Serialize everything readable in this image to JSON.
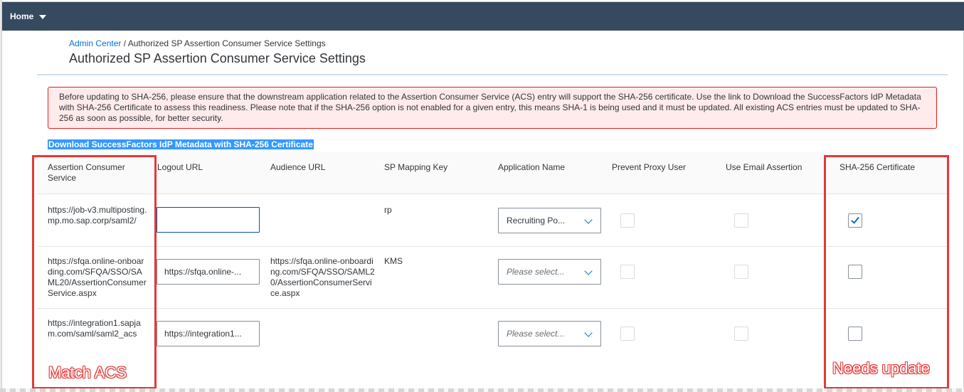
{
  "topbar": {
    "home_label": "Home"
  },
  "breadcrumb": {
    "link": "Admin Center",
    "separator": "/",
    "current": "Authorized SP Assertion Consumer Service Settings"
  },
  "page_title": "Authorized SP Assertion Consumer Service Settings",
  "alert_text": "Before updating to SHA-256, please ensure that the downstream application related to the Assertion Consumer Service (ACS) entry will support the SHA-256 certificate. Use the link to Download the SuccessFactors IdP Metadata with SHA-256 Certificate to assess this readiness. Please note that if the SHA-256 option is not enabled for a given entry, this means SHA-1 is being used and it must be updated. All existing ACS entries must be updated to SHA-256 as soon as possible, for better security.",
  "download_link": "Download SuccessFactors IdP Metadata with SHA-256 Certificate",
  "table": {
    "headers": {
      "acs": "Assertion Consumer Service",
      "logout": "Logout URL",
      "audience": "Audience URL",
      "mapping": "SP Mapping Key",
      "app": "Application Name",
      "proxy": "Prevent Proxy User",
      "email": "Use Email Assertion",
      "sha": "SHA-256 Certificate"
    },
    "rows": [
      {
        "acs": "https://job-v3.multiposting.mp.mo.sap.corp/saml2/",
        "logout": "",
        "audience": "",
        "mapping": "rp",
        "app": "Recruiting Po...",
        "prevent_proxy": false,
        "use_email": false,
        "sha256": true
      },
      {
        "acs": "https://sfqa.online-onboarding.com/SFQA/SSO/SAML20/AssertionConsumerService.aspx",
        "logout": "https://sfqa.online-...",
        "audience": "https://sfqa.online-onboarding.com/SFQA/SSO/SAML20/AssertionConsumerService.aspx",
        "mapping": "KMS",
        "app": "Please select...",
        "prevent_proxy": false,
        "use_email": false,
        "sha256": false
      },
      {
        "acs": "https://integration1.sapjam.com/saml/saml2_acs",
        "logout": "https://integration1...",
        "audience": "",
        "mapping": "",
        "app": "Please select...",
        "prevent_proxy": false,
        "use_email": false,
        "sha256": false
      }
    ]
  },
  "annotations": {
    "left": "Match ACS",
    "right": "Needs update",
    "color": "#e53935"
  }
}
